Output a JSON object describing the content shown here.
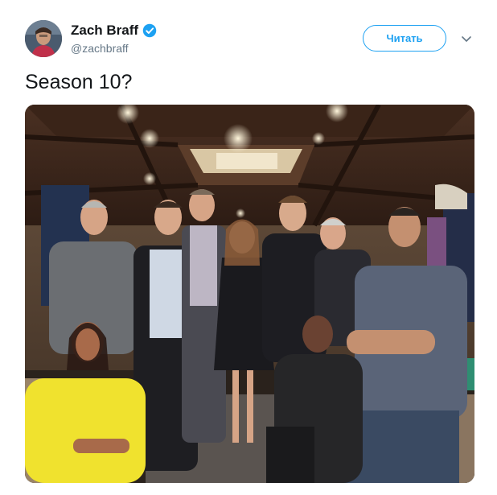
{
  "user": {
    "display_name": "Zach Braff",
    "handle": "@zachbraff",
    "verified": true
  },
  "actions": {
    "follow_label": "Читать"
  },
  "tweet": {
    "text": "Season 10?"
  },
  "icons": {
    "verified": "verified-badge-icon",
    "caret": "chevron-down-icon"
  },
  "colors": {
    "accent": "#1da1f2",
    "text_primary": "#14171a",
    "text_secondary": "#657786"
  }
}
